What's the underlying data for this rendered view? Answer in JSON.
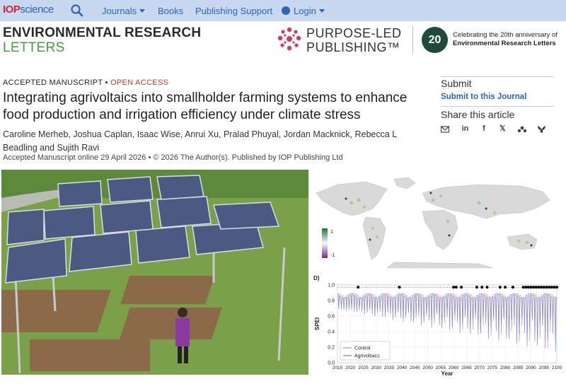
{
  "topnav": {
    "logo_iop": "IOP",
    "logo_science": "science",
    "items": [
      "Journals",
      "Books",
      "Publishing Support",
      "Login"
    ]
  },
  "journal": {
    "title_line1": "ENVIRONMENTAL RESEARCH",
    "title_line2": "LETTERS",
    "brand_line1": "PURPOSE-LED",
    "brand_line2": "PUBLISHING™",
    "anniversary_badge": "20",
    "anniversary_line1": "Celebrating the 20th anniversary of",
    "anniversary_line2": "Environmental Research Letters"
  },
  "article": {
    "kicker_accepted": "ACCEPTED MANUSCRIPT",
    "kicker_sep": " • ",
    "kicker_open": "OPEN ACCESS",
    "title": "Integrating agrivoltaics into smallholder farming systems to enhance food production and irrigation efficiency under climate stress",
    "authors": "Caroline Merheb, Joshua Caplan, Isaac Wise, Anrui Xu, Pralad Phuyal, Jordan Macknick, Rebecca L Beadling and Sujith Ravi",
    "pubinfo": "Accepted Manuscript online 29 April 2026 • © 2026 The Author(s). Published by IOP Publishing Ltd"
  },
  "sidebar": {
    "submit_heading": "Submit",
    "submit_link": "Submit to this Journal",
    "share_heading": "Share this article",
    "share_icons": [
      "email-icon",
      "linkedin-icon",
      "facebook-icon",
      "x-icon",
      "mendeley-icon",
      "bluesky-icon"
    ]
  },
  "map_legend": {
    "max": "1",
    "min": "-1"
  },
  "colors": {
    "accent": "#2a66b5",
    "nav_bg": "#c9d8f1",
    "brand_green": "#4a9b45",
    "open_access": "#c7362b",
    "control": "#e8868d",
    "agrivoltaics": "#6a84c7"
  },
  "chart_data": {
    "type": "line",
    "panel_label": "D)",
    "xlabel": "Year",
    "ylabel": "SPEI",
    "xlim": [
      2015,
      2100
    ],
    "ylim": [
      0.0,
      1.0
    ],
    "xticks": [
      2015,
      2020,
      2025,
      2030,
      2035,
      2040,
      2045,
      2050,
      2055,
      2060,
      2065,
      2070,
      2075,
      2080,
      2085,
      2090,
      2095,
      2100
    ],
    "yticks": [
      0.0,
      0.2,
      0.4,
      0.6,
      0.8,
      1.0
    ],
    "series": [
      {
        "name": "Control",
        "color": "#e8868d"
      },
      {
        "name": "Agrivoltaics",
        "color": "#6a84c7"
      }
    ],
    "significance_marker_y": 0.97,
    "significance_years": [
      2023,
      2039,
      2060,
      2061,
      2063,
      2069,
      2071,
      2073,
      2078,
      2080,
      2083,
      2087,
      2088,
      2089,
      2090,
      2091,
      2092,
      2093,
      2094,
      2095,
      2096,
      2097,
      2098,
      2099,
      2100
    ]
  }
}
